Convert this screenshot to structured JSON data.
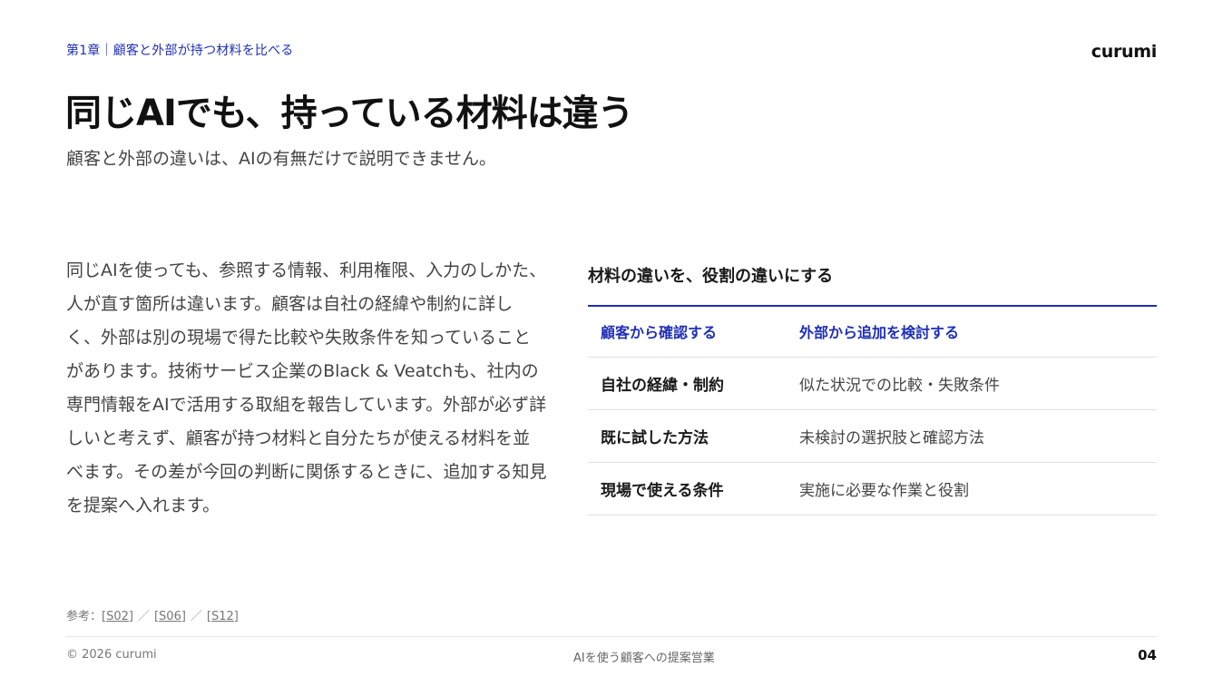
{
  "header": {
    "chapter": "第1章｜顧客と外部が持つ材料を比べる",
    "brand": "curumi",
    "title": "同じAIでも、持っている材料は違う",
    "subtitle": "顧客と外部の違いは、AIの有無だけで説明できません。"
  },
  "main": {
    "body": "同じAIを使っても、参照する情報、利用権限、入力のしかた、人が直す箇所は違います。顧客は自社の経緯や制約に詳しく、外部は別の現場で得た比較や失敗条件を知っていることがあります。技術サービス企業のBlack & Veatchも、社内の専門情報をAIで活用する取組を報告しています。外部が必ず詳しいと考えず、顧客が持つ材料と自分たちが使える材料を並べます。その差が今回の判断に関係するときに、追加する知見を提案へ入れます。"
  },
  "table": {
    "title": "材料の違いを、役割の違いにする",
    "headers": [
      "顧客から確認する",
      "外部から追加を検討する"
    ],
    "rows": [
      [
        "自社の経緯・制約",
        "似た状況での比較・失敗条件"
      ],
      [
        "既に試した方法",
        "未検討の選択肢と確認方法"
      ],
      [
        "現場で使える条件",
        "実施に必要な作業と役割"
      ]
    ]
  },
  "references": {
    "label": "参考：",
    "items": [
      "[S02]",
      "[S06]",
      "[S12]"
    ],
    "separator": "／"
  },
  "footer": {
    "copyright": "© 2026 curumi",
    "center": "AIを使う顧客への提案営業",
    "page": "04"
  },
  "colors": {
    "accent": "#1f2fb8",
    "text": "#1a1a1a",
    "muted": "#444444"
  }
}
